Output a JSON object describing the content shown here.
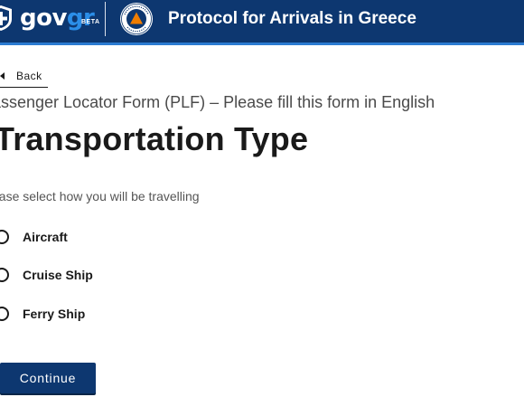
{
  "header": {
    "logo_gov": "gov",
    "logo_gr": "gr",
    "beta": "BETA",
    "title": "Protocol for Arrivals in Greece"
  },
  "back_label": "Back",
  "subtitle": "assenger Locator Form (PLF) – Please fill this form in English",
  "title": "Transportation Type",
  "hint": "ease select how you will be travelling",
  "options": [
    {
      "label": "Aircraft",
      "selected": false
    },
    {
      "label": "Cruise Ship",
      "selected": false
    },
    {
      "label": "Ferry Ship",
      "selected": false
    }
  ],
  "continue_label": "Continue",
  "colors": {
    "header_bg": "#0d3770",
    "header_accent": "#2b7bd1",
    "logo_gr": "#2b8ee8",
    "button_bg": "#0d3770"
  },
  "icons": [
    "greek-emblem-icon",
    "civil-protection-logo-icon",
    "caret-left-icon",
    "radio-icon"
  ]
}
